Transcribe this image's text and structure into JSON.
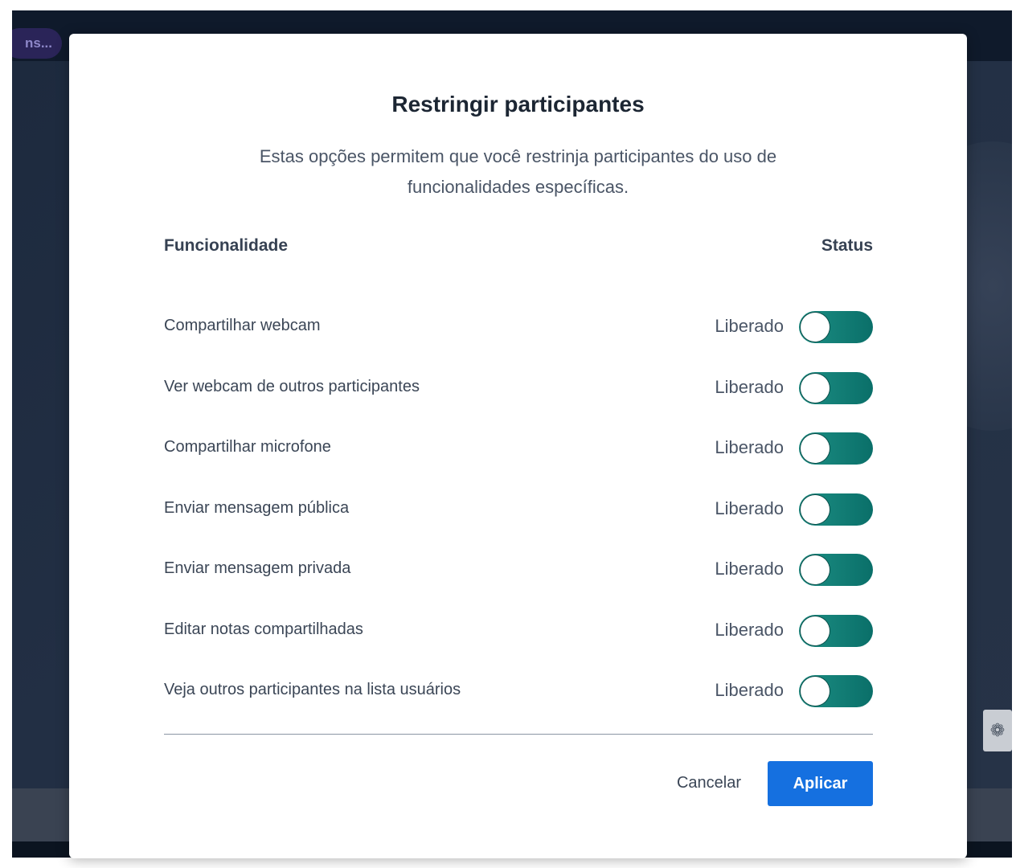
{
  "background": {
    "pill_label": "ns..."
  },
  "modal": {
    "title": "Restringir participantes",
    "description": "Estas opções permitem que você restrinja participantes do uso de funcionalidades específicas.",
    "header": {
      "feature": "Funcionalidade",
      "status": "Status"
    },
    "rows": [
      {
        "label": "Compartilhar webcam",
        "status": "Liberado"
      },
      {
        "label": "Ver webcam de outros participantes",
        "status": "Liberado"
      },
      {
        "label": "Compartilhar microfone",
        "status": "Liberado"
      },
      {
        "label": "Enviar mensagem pública",
        "status": "Liberado"
      },
      {
        "label": "Enviar mensagem privada",
        "status": "Liberado"
      },
      {
        "label": "Editar notas compartilhadas",
        "status": "Liberado"
      },
      {
        "label": "Veja outros participantes na lista usuários",
        "status": "Liberado"
      }
    ],
    "cancel_label": "Cancelar",
    "apply_label": "Aplicar"
  },
  "colors": {
    "toggle_on": "#0f7a73",
    "primary_button": "#1570e0",
    "overlay": "#0f1a2b"
  }
}
